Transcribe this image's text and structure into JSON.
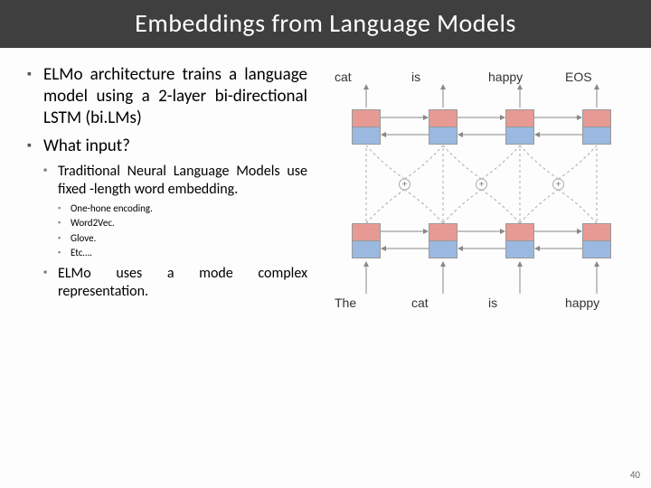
{
  "title": "Embeddings from Language Models",
  "bullets": {
    "b1": "ELMo architecture trains a language model using a 2-layer bi-directional LSTM (bi.LMs)",
    "b2": "What input?",
    "s1": "Traditional Neural Language Models use fixed -length word embedding.",
    "t1": "One-hone encoding.",
    "t2": "Word2Vec.",
    "t3": "Glove.",
    "t4": "Etc….",
    "s2": "ELMo uses a mode complex representation."
  },
  "diagram": {
    "top_words": [
      "cat",
      "is",
      "happy",
      "EOS"
    ],
    "bottom_words": [
      "The",
      "cat",
      "is",
      "happy"
    ]
  },
  "page": "40"
}
